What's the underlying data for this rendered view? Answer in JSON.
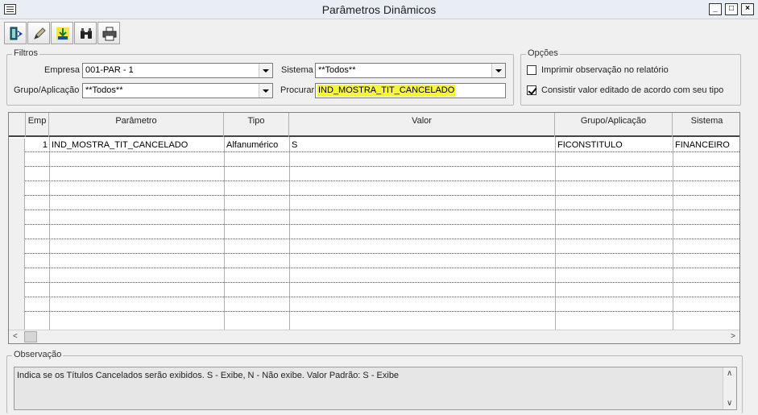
{
  "window": {
    "title": "Parâmetros Dinâmicos"
  },
  "toolbar": {
    "buttons": [
      {
        "name": "exit",
        "icon": "exit-door-icon"
      },
      {
        "name": "edit",
        "icon": "pencil-icon"
      },
      {
        "name": "save",
        "icon": "download-icon"
      },
      {
        "name": "search",
        "icon": "binoculars-icon"
      },
      {
        "name": "print",
        "icon": "printer-icon"
      }
    ]
  },
  "filters": {
    "legend": "Filtros",
    "empresa_label": "Empresa",
    "empresa_value": "001-PAR - 1",
    "sistema_label": "Sistema",
    "sistema_value": "**Todos**",
    "grupo_label": "Grupo/Aplicação",
    "grupo_value": "**Todos**",
    "procurar_label": "Procurar",
    "procurar_value": "IND_MOSTRA_TIT_CANCELADO"
  },
  "options": {
    "legend": "Opções",
    "imprimir_label": "Imprimir observação no relatório",
    "imprimir_checked": false,
    "consistir_label": "Consistir valor editado de acordo com seu tipo",
    "consistir_checked": true
  },
  "grid": {
    "columns": [
      "Emp",
      "Parâmetro",
      "Tipo",
      "Valor",
      "Grupo/Aplicação",
      "Sistema"
    ],
    "rows": [
      {
        "emp": "1",
        "parametro": "IND_MOSTRA_TIT_CANCELADO",
        "tipo": "Alfanumérico",
        "valor": "S",
        "grupo": "FICONSTITULO",
        "sistema": "FINANCEIRO"
      }
    ]
  },
  "observacao": {
    "legend": "Observação",
    "text": "Indica se os Títulos Cancelados serão exibidos. S - Exibe, N - Não exibe. Valor Padrão: S - Exibe"
  },
  "colors": {
    "highlight": "#f5f53a",
    "titlebar": "#e9eef5"
  }
}
